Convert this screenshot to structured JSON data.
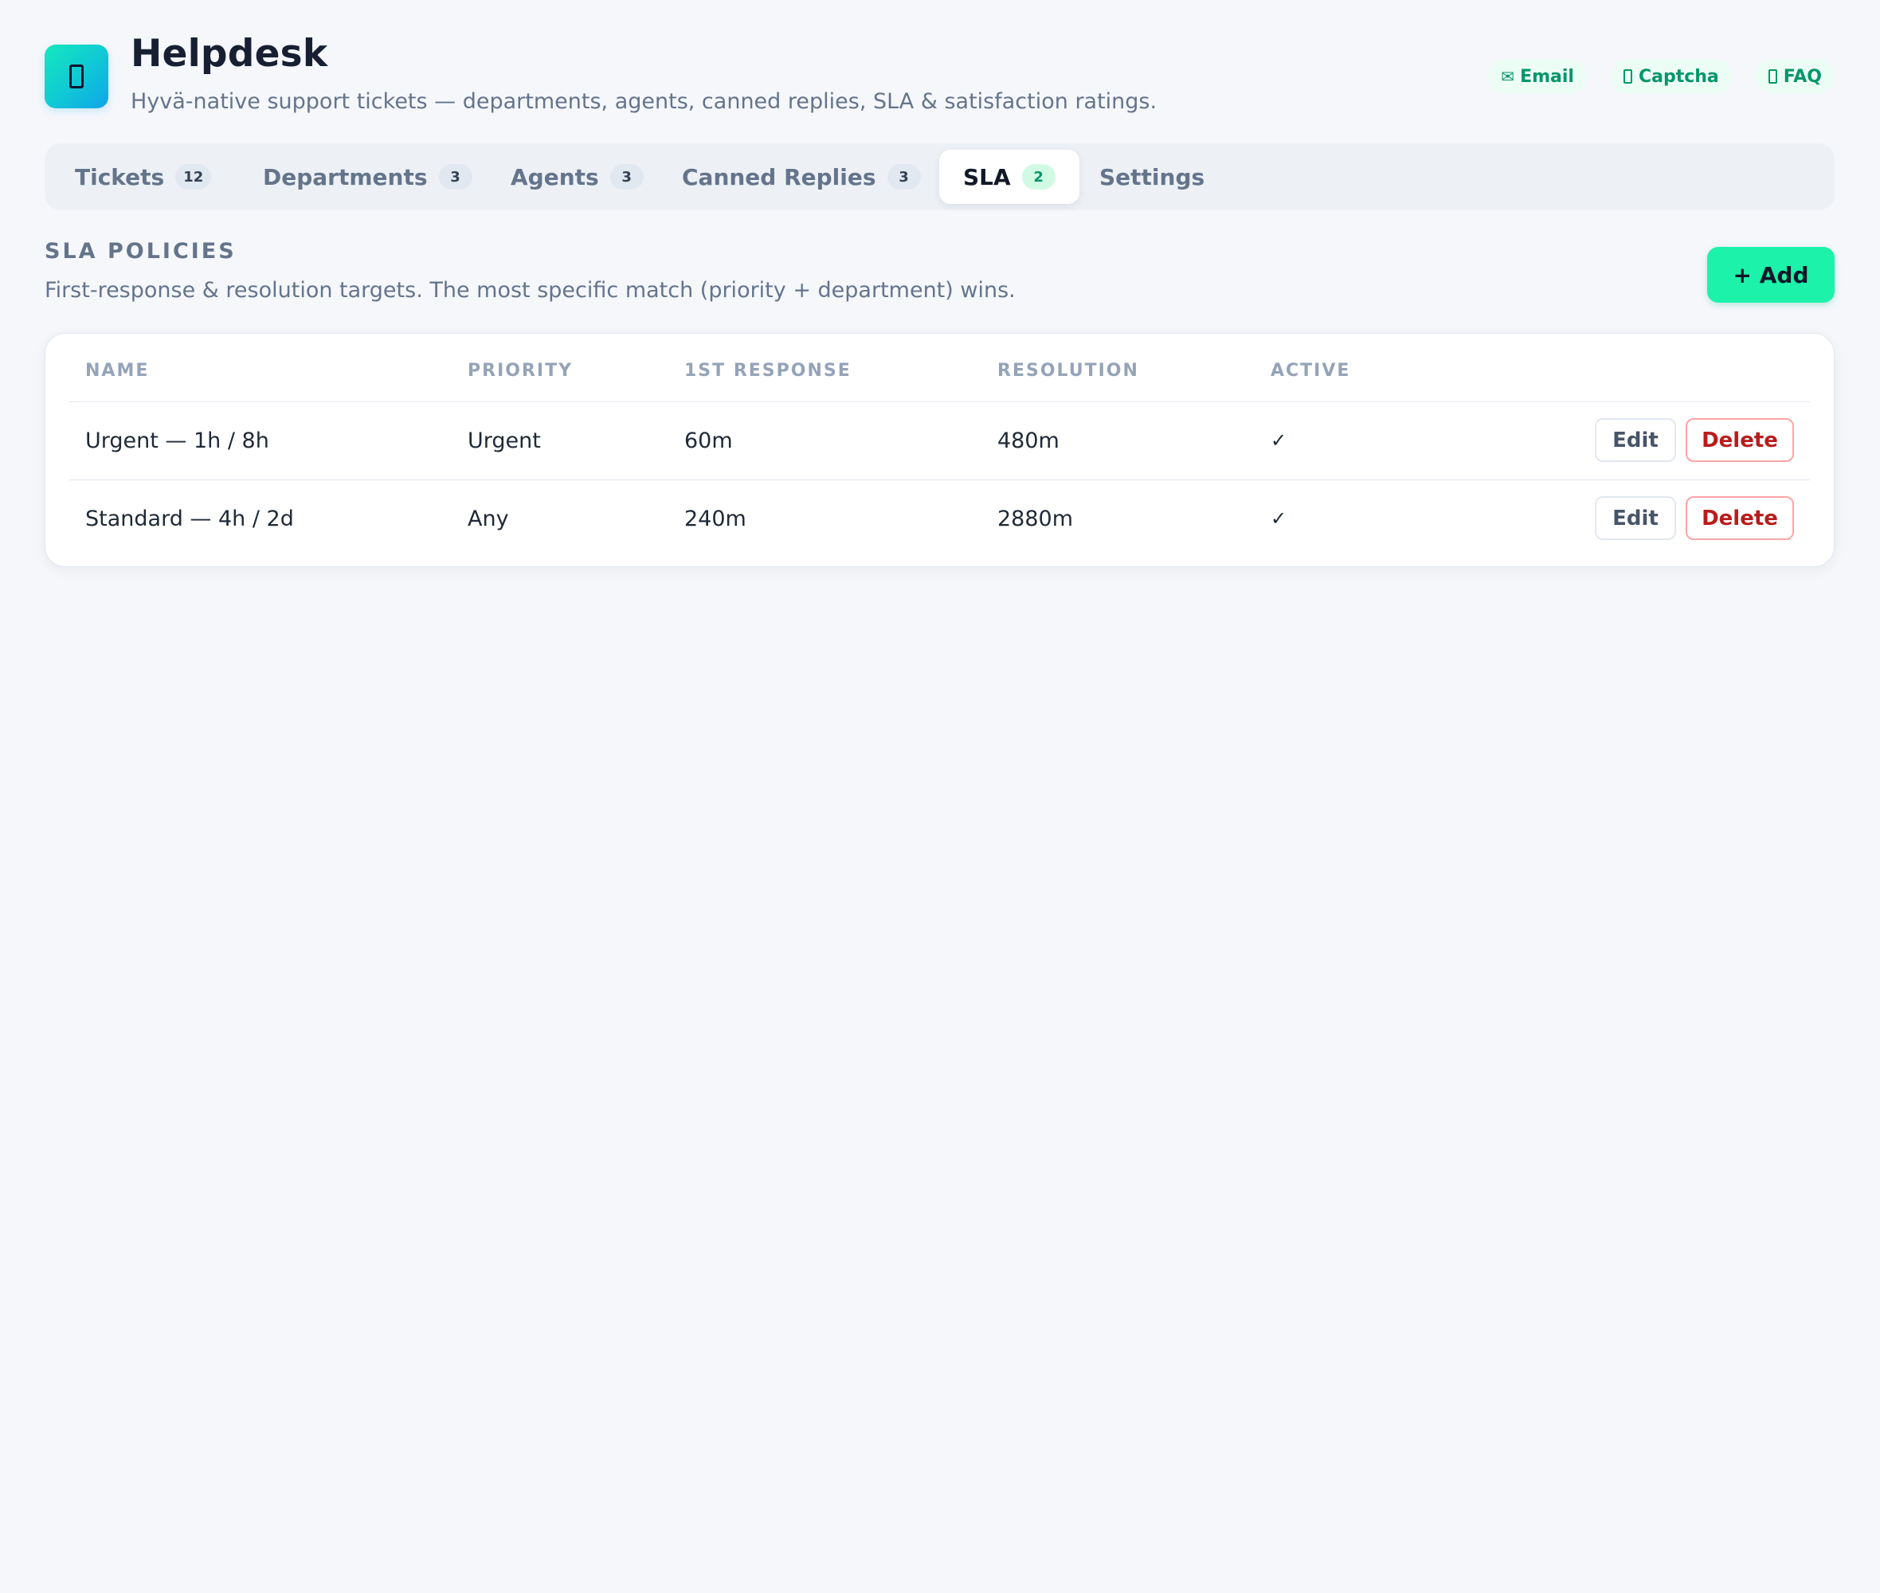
{
  "header": {
    "title": "Helpdesk",
    "subtitle": "Hyvä-native support tickets — departments, agents, canned replies, SLA & satisfaction ratings.",
    "logo_icon": "ticket-icon",
    "chips": [
      {
        "icon": "✉",
        "icon_name": "envelope-icon",
        "label": "Email"
      },
      {
        "icon_name": "shield-icon",
        "label": "Captcha"
      },
      {
        "icon_name": "book-icon",
        "label": "FAQ"
      }
    ]
  },
  "tabs": [
    {
      "label": "Tickets",
      "count": "12"
    },
    {
      "label": "Departments",
      "count": "3"
    },
    {
      "label": "Agents",
      "count": "3"
    },
    {
      "label": "Canned Replies",
      "count": "3"
    },
    {
      "label": "SLA",
      "count": "2",
      "active": true
    },
    {
      "label": "Settings"
    }
  ],
  "section": {
    "title": "SLA POLICIES",
    "description": "First-response & resolution targets. The most specific match (priority + department) wins.",
    "add_label": "+ Add"
  },
  "table": {
    "columns": [
      "NAME",
      "PRIORITY",
      "1ST RESPONSE",
      "RESOLUTION",
      "ACTIVE"
    ],
    "rows": [
      {
        "name": "Urgent — 1h / 8h",
        "priority": "Urgent",
        "first_response": "60m",
        "resolution": "480m",
        "active": "✓"
      },
      {
        "name": "Standard — 4h / 2d",
        "priority": "Any",
        "first_response": "240m",
        "resolution": "2880m",
        "active": "✓"
      }
    ],
    "edit_label": "Edit",
    "delete_label": "Delete"
  },
  "colors": {
    "accent": "#1cf2aa",
    "accent_text": "#059669",
    "danger": "#b91c1c",
    "background": "#f5f7fb"
  }
}
